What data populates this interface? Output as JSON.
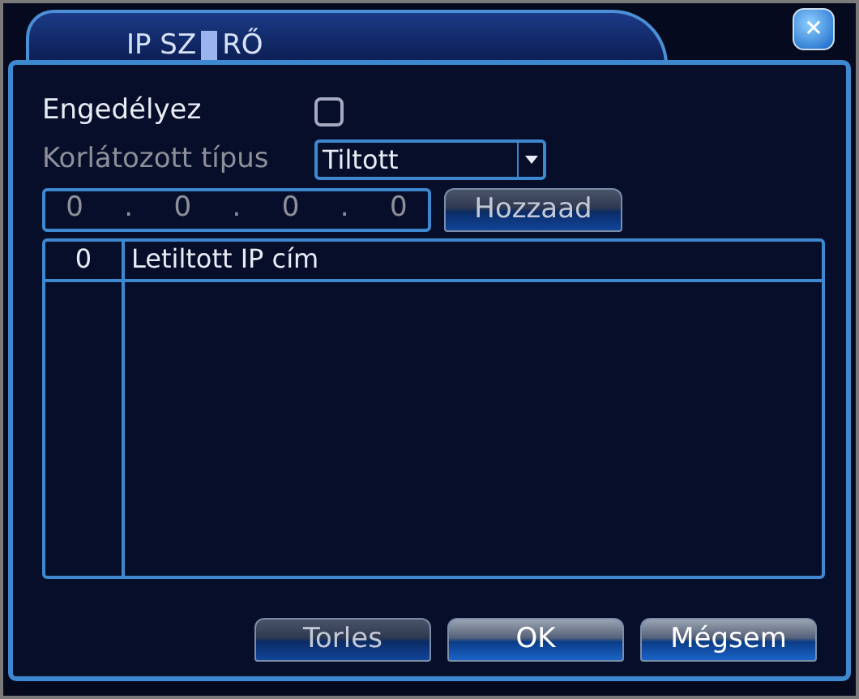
{
  "window": {
    "title_before_cursor": "IP SZ",
    "title_after_cursor": "RŐ",
    "close": "✕"
  },
  "enable": {
    "label": "Engedélyez",
    "checked": false
  },
  "restriction": {
    "label": "Korlátozott típus",
    "disabled": true,
    "value": "Tiltott"
  },
  "ip_field": {
    "octets": [
      "0",
      "0",
      "0",
      "0"
    ],
    "separator": "."
  },
  "add_button": {
    "label": "Hozzaad",
    "disabled": true
  },
  "table": {
    "columns": [
      "0",
      "Letiltott IP cím"
    ]
  },
  "buttons": [
    {
      "label": "Torles",
      "disabled": true
    },
    {
      "label": "OK",
      "disabled": false
    },
    {
      "label": "Mégsem",
      "disabled": false
    }
  ]
}
